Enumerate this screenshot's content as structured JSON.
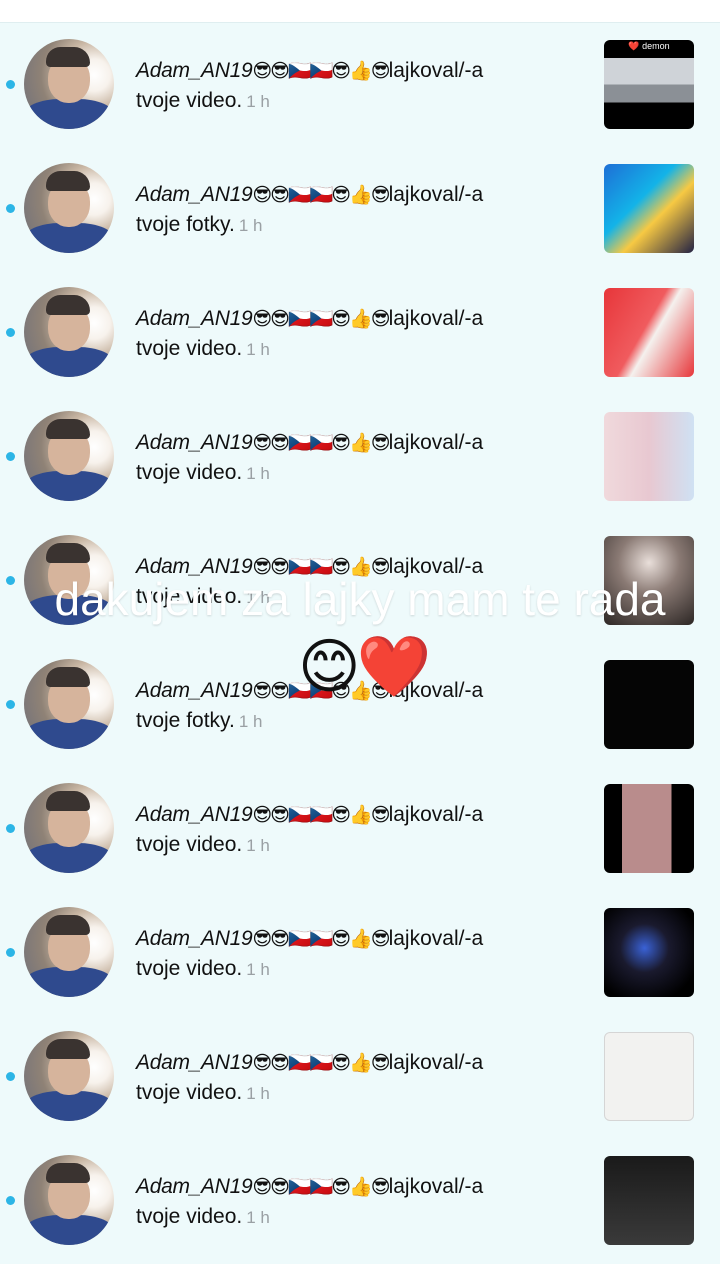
{
  "notifications": [
    {
      "user": "Adam_AN19",
      "emojis": "😎😎🇨🇿🇨🇿😎👍😎",
      "verb": "lajkoval/-a",
      "object": "tvoje video.",
      "time": "1 h",
      "thumb_text": "❤️ demon",
      "thumb_style": "t0"
    },
    {
      "user": "Adam_AN19",
      "emojis": "😎😎🇨🇿🇨🇿😎👍😎",
      "verb": "lajkoval/-a",
      "object": "tvoje fotky.",
      "time": "1 h",
      "thumb_text": "",
      "thumb_style": "t1"
    },
    {
      "user": "Adam_AN19",
      "emojis": "😎😎🇨🇿🇨🇿😎👍😎",
      "verb": "lajkoval/-a",
      "object": "tvoje video.",
      "time": "1 h",
      "thumb_text": "",
      "thumb_style": "t2"
    },
    {
      "user": "Adam_AN19",
      "emojis": "😎😎🇨🇿🇨🇿😎👍😎",
      "verb": "lajkoval/-a",
      "object": "tvoje video.",
      "time": "1 h",
      "thumb_text": "",
      "thumb_style": "t3"
    },
    {
      "user": "Adam_AN19",
      "emojis": "😎😎🇨🇿🇨🇿😎👍😎",
      "verb": "lajkoval/-a",
      "object": "tvoje video.",
      "time": "1 h",
      "thumb_text": "",
      "thumb_style": "t4"
    },
    {
      "user": "Adam_AN19",
      "emojis": "😎😎🇨🇿🇨🇿😎👍😎",
      "verb": "lajkoval/-a",
      "object": "tvoje fotky.",
      "time": "1 h",
      "thumb_text": "",
      "thumb_style": "t5"
    },
    {
      "user": "Adam_AN19",
      "emojis": "😎😎🇨🇿🇨🇿😎👍😎",
      "verb": "lajkoval/-a",
      "object": "tvoje video.",
      "time": "1 h",
      "thumb_text": "",
      "thumb_style": "t6"
    },
    {
      "user": "Adam_AN19",
      "emojis": "😎😎🇨🇿🇨🇿😎👍😎",
      "verb": "lajkoval/-a",
      "object": "tvoje video.",
      "time": "1 h",
      "thumb_text": "",
      "thumb_style": "t7"
    },
    {
      "user": "Adam_AN19",
      "emojis": "😎😎🇨🇿🇨🇿😎👍😎",
      "verb": "lajkoval/-a",
      "object": "tvoje video.",
      "time": "1 h",
      "thumb_text": "",
      "thumb_style": "t8"
    },
    {
      "user": "Adam_AN19",
      "emojis": "😎😎🇨🇿🇨🇿😎👍😎",
      "verb": "lajkoval/-a",
      "object": "tvoje video.",
      "time": "1 h",
      "thumb_text": "",
      "thumb_style": "t9"
    }
  ],
  "overlay": {
    "caption": "dakujem za lajky mam te rada",
    "emoji": "😊❤️"
  },
  "colors": {
    "background": "#eefafb",
    "unread_dot": "#2cb5e6",
    "time_text": "#9aa0a4"
  }
}
